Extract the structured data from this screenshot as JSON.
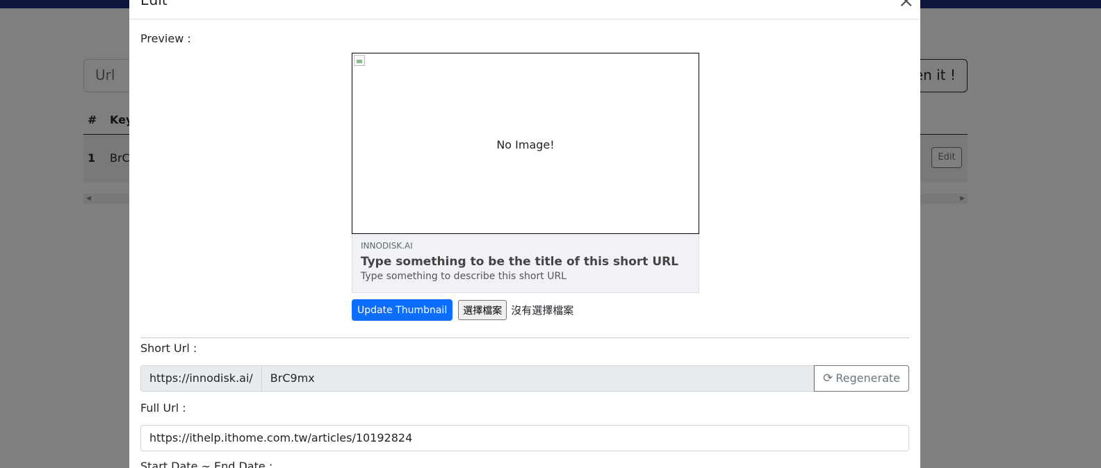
{
  "background": {
    "url_placeholder": "Url",
    "shorten_label": "en it !",
    "table_headers": [
      "#",
      "Key"
    ],
    "row": {
      "index": "1",
      "key": "BrC"
    },
    "edit_label": "Edit"
  },
  "modal": {
    "title": "Edit",
    "close_icon": "×",
    "preview_label": "Preview :",
    "no_image_text": "No Image!",
    "meta": {
      "domain": "INNODISK.AI",
      "title": "Type something to be the title of this short URL",
      "description": "Type something to describe this short URL"
    },
    "update_thumbnail_label": "Update Thumbnail",
    "choose_file_label": "選擇檔案",
    "no_file_label": "沒有選擇檔案",
    "short_url_label": "Short Url :",
    "short_url_prefix": "https://innodisk.ai/",
    "short_url_key": "BrC9mx",
    "regenerate_label": "Regenerate",
    "full_url_label": "Full Url :",
    "full_url_value": "https://ithelp.ithome.com.tw/articles/10192824",
    "next_label_cut": "Start Date ~ End Date :"
  },
  "colors": {
    "primary": "#0d6efd",
    "topbar": "#1d2b7a"
  }
}
